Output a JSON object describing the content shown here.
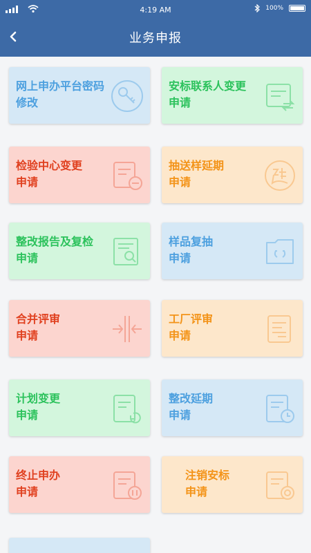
{
  "status": {
    "time": "4:19 AM",
    "battery": "100%"
  },
  "header": {
    "title": "业务申报"
  },
  "cards": [
    {
      "line1": "网上申办平台密码",
      "line2": "修改",
      "icon": "key-icon",
      "color": "blue"
    },
    {
      "line1": "安标联系人变更",
      "line2": "申请",
      "icon": "contact-change-icon",
      "color": "green"
    },
    {
      "line1": "检验中心变更",
      "line2": "申请",
      "icon": "document-minus-icon",
      "color": "red"
    },
    {
      "line1": "抽送样延期",
      "line2": "申请",
      "icon": "delay-icon",
      "color": "orange"
    },
    {
      "line1": "整改报告及复检",
      "line2": "申请",
      "icon": "report-search-icon",
      "color": "green"
    },
    {
      "line1": "样品复抽",
      "line2": "申请",
      "icon": "sample-refresh-icon",
      "color": "blue"
    },
    {
      "line1": "合并评审",
      "line2": "申请",
      "icon": "merge-icon",
      "color": "red"
    },
    {
      "line1": "工厂评审",
      "line2": "申请",
      "icon": "document-icon",
      "color": "orange"
    },
    {
      "line1": "计划变更",
      "line2": "申请",
      "icon": "plan-change-icon",
      "color": "green"
    },
    {
      "line1": "整改延期",
      "line2": "申请",
      "icon": "document-clock-icon",
      "color": "blue"
    },
    {
      "line1": "终止申办",
      "line2": "申请",
      "icon": "document-stop-icon",
      "color": "red"
    },
    {
      "line1": "注销安标",
      "line2": "申请",
      "icon": "document-cancel-icon",
      "color": "orange"
    },
    {
      "line1": "",
      "line2": "",
      "icon": "",
      "color": "blue"
    }
  ]
}
